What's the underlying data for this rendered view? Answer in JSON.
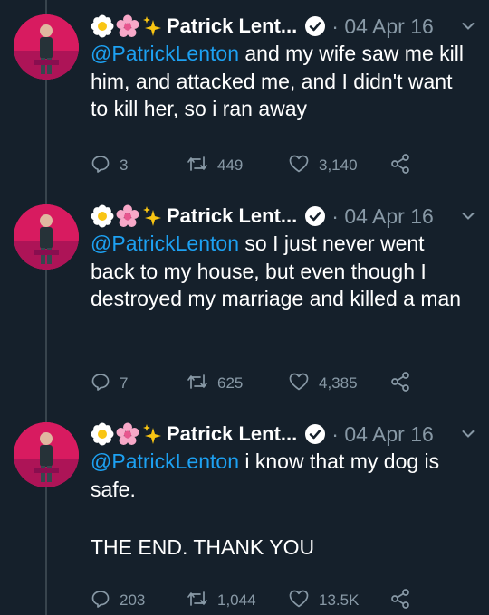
{
  "tweets": [
    {
      "emoji": [
        "daisy",
        "cherry-blossom",
        "sparkles"
      ],
      "name": "Patrick Lent...",
      "date": "· 04 Apr 16",
      "mention": "@PatrickLenton",
      "text": " and my wife saw me kill him, and attacked me, and I didn't want to kill her, so i ran away",
      "text2": "",
      "replies": "3",
      "retweets": "449",
      "likes": "3,140"
    },
    {
      "emoji": [
        "daisy",
        "cherry-blossom",
        "sparkles"
      ],
      "name": "Patrick Lent...",
      "date": "· 04 Apr 16",
      "mention": "@PatrickLenton",
      "text": " so I just never went back to my house, but even though I destroyed my marriage and killed a man",
      "text2": "",
      "replies": "7",
      "retweets": "625",
      "likes": "4,385"
    },
    {
      "emoji": [
        "daisy",
        "cherry-blossom",
        "sparkles"
      ],
      "name": "Patrick Lent...",
      "date": "· 04 Apr 16",
      "mention": "@PatrickLenton",
      "text": " i know that my dog is safe.",
      "text2": "THE END. THANK YOU",
      "replies": "203",
      "retweets": "1,044",
      "likes": "13.5K"
    }
  ],
  "colors": {
    "background": "#15202b",
    "mention": "#1da1f2",
    "muted": "#8899a6",
    "thread_line": "#38444d"
  }
}
